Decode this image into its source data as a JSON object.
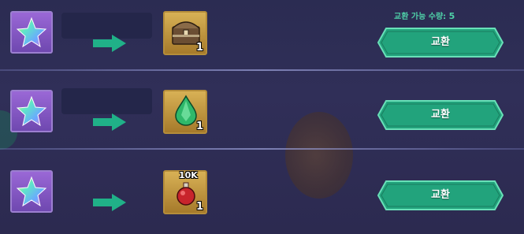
{
  "colors": {
    "background": "#2d2c54",
    "button": "#22a37c",
    "button_border": "#69e0b8",
    "currency_slot": "#8a5fd0",
    "reward_slot": "#c79b45",
    "arrow": "#1fc08e",
    "limit_text": "#4fd0a8"
  },
  "exchange_limit": {
    "label": "교환 가능 수량:",
    "value": "5"
  },
  "rows": [
    {
      "cost_icon": "rainbow-star-icon",
      "reward_icon": "treasure-chest-icon",
      "reward_qty": "1",
      "badge": "",
      "button_label": "교환"
    },
    {
      "cost_icon": "rainbow-star-icon",
      "reward_icon": "green-crystal-drop-icon",
      "reward_qty": "1",
      "badge": "",
      "button_label": "교환"
    },
    {
      "cost_icon": "rainbow-star-icon",
      "reward_icon": "red-potion-icon",
      "reward_qty": "1",
      "badge": "10K",
      "button_label": "교환"
    }
  ]
}
